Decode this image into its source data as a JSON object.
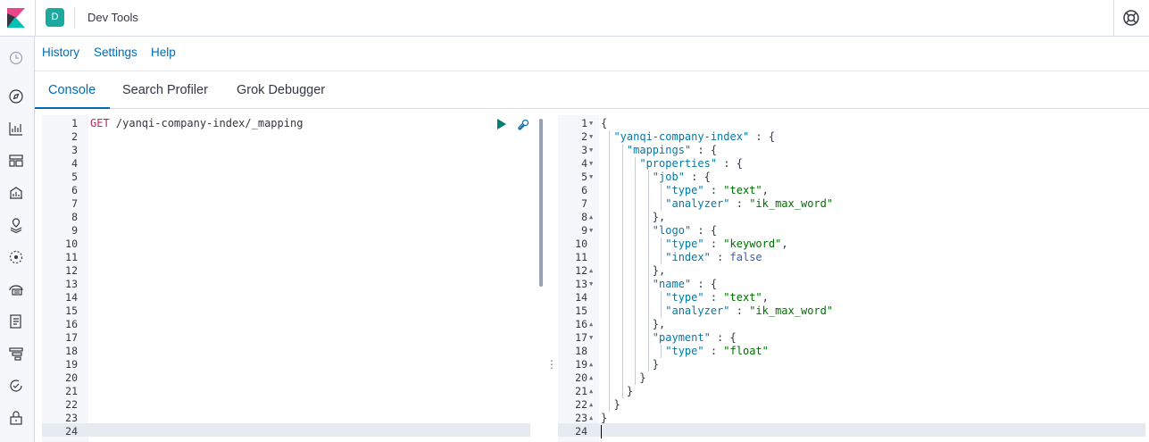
{
  "header": {
    "space_initial": "D",
    "app_title": "Dev Tools",
    "logo_icon": "kibana-logo-icon",
    "help_icon": "lifebuoy-icon"
  },
  "sidenav": {
    "items": [
      {
        "icon": "clock-icon"
      },
      {
        "icon": "compass-icon"
      },
      {
        "icon": "visualize-icon"
      },
      {
        "icon": "dashboard-icon"
      },
      {
        "icon": "canvas-icon"
      },
      {
        "icon": "maps-icon"
      },
      {
        "icon": "ml-icon"
      },
      {
        "icon": "infrastructure-icon"
      },
      {
        "icon": "logs-icon"
      },
      {
        "icon": "apm-icon"
      },
      {
        "icon": "uptime-icon"
      },
      {
        "icon": "siem-icon"
      }
    ]
  },
  "topnav": {
    "history": "History",
    "settings": "Settings",
    "help": "Help"
  },
  "tabs": {
    "console": "Console",
    "search_profiler": "Search Profiler",
    "grok_debugger": "Grok Debugger",
    "active": "Console"
  },
  "request": {
    "method": "GET",
    "path": " /yanqi-company-index/_mapping",
    "line_count": 24,
    "active_line": 24
  },
  "response": {
    "line_count": 24,
    "active_line": 24,
    "lines": [
      [
        [
          "p",
          "{"
        ]
      ],
      [
        [
          "p",
          "  "
        ],
        [
          "k",
          "\"yanqi-company-index\""
        ],
        [
          "p",
          " : {"
        ]
      ],
      [
        [
          "p",
          "    "
        ],
        [
          "k",
          "\"mappings\""
        ],
        [
          "p",
          " : {"
        ]
      ],
      [
        [
          "p",
          "      "
        ],
        [
          "k",
          "\"properties\""
        ],
        [
          "p",
          " : {"
        ]
      ],
      [
        [
          "p",
          "        "
        ],
        [
          "k",
          "\"job\""
        ],
        [
          "p",
          " : {"
        ]
      ],
      [
        [
          "p",
          "          "
        ],
        [
          "k",
          "\"type\""
        ],
        [
          "p",
          " : "
        ],
        [
          "s",
          "\"text\""
        ],
        [
          "p",
          ","
        ]
      ],
      [
        [
          "p",
          "          "
        ],
        [
          "k",
          "\"analyzer\""
        ],
        [
          "p",
          " : "
        ],
        [
          "s",
          "\"ik_max_word\""
        ]
      ],
      [
        [
          "p",
          "        },"
        ]
      ],
      [
        [
          "p",
          "        "
        ],
        [
          "k",
          "\"logo\""
        ],
        [
          "p",
          " : {"
        ]
      ],
      [
        [
          "p",
          "          "
        ],
        [
          "k",
          "\"type\""
        ],
        [
          "p",
          " : "
        ],
        [
          "s",
          "\"keyword\""
        ],
        [
          "p",
          ","
        ]
      ],
      [
        [
          "p",
          "          "
        ],
        [
          "k",
          "\"index\""
        ],
        [
          "p",
          " : "
        ],
        [
          "b",
          "false"
        ]
      ],
      [
        [
          "p",
          "        },"
        ]
      ],
      [
        [
          "p",
          "        "
        ],
        [
          "k",
          "\"name\""
        ],
        [
          "p",
          " : {"
        ]
      ],
      [
        [
          "p",
          "          "
        ],
        [
          "k",
          "\"type\""
        ],
        [
          "p",
          " : "
        ],
        [
          "s",
          "\"text\""
        ],
        [
          "p",
          ","
        ]
      ],
      [
        [
          "p",
          "          "
        ],
        [
          "k",
          "\"analyzer\""
        ],
        [
          "p",
          " : "
        ],
        [
          "s",
          "\"ik_max_word\""
        ]
      ],
      [
        [
          "p",
          "        },"
        ]
      ],
      [
        [
          "p",
          "        "
        ],
        [
          "k",
          "\"payment\""
        ],
        [
          "p",
          " : {"
        ]
      ],
      [
        [
          "p",
          "          "
        ],
        [
          "k",
          "\"type\""
        ],
        [
          "p",
          " : "
        ],
        [
          "s",
          "\"float\""
        ]
      ],
      [
        [
          "p",
          "        }"
        ]
      ],
      [
        [
          "p",
          "      }"
        ]
      ],
      [
        [
          "p",
          "    }"
        ]
      ],
      [
        [
          "p",
          "  }"
        ]
      ],
      [
        [
          "p",
          "}"
        ]
      ],
      [
        [
          "p",
          ""
        ]
      ]
    ],
    "folds": {
      "1": "open",
      "2": "open",
      "3": "open",
      "4": "open",
      "5": "open",
      "8": "close",
      "9": "open",
      "12": "close",
      "13": "open",
      "16": "close",
      "17": "open",
      "19": "close",
      "20": "close",
      "21": "close",
      "22": "close",
      "23": "close"
    }
  }
}
